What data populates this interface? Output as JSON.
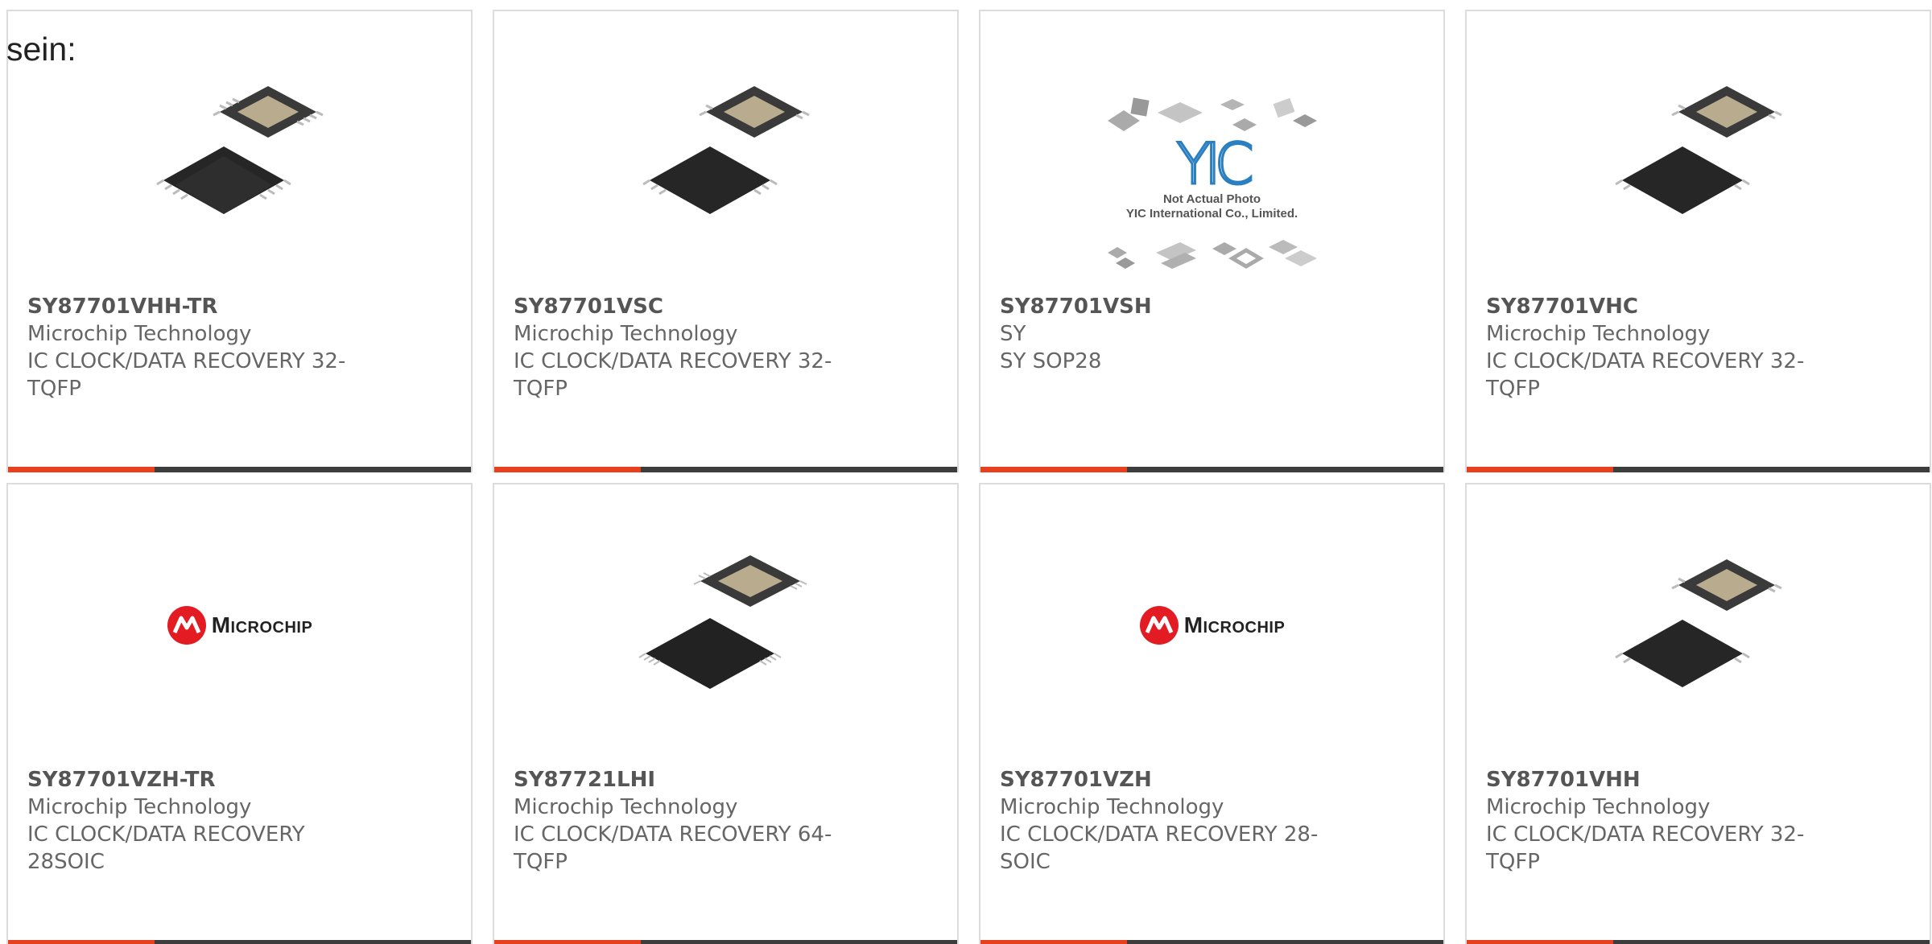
{
  "intro_text": "sein:",
  "colors": {
    "accent": "#e8401f",
    "bar": "#3d3d3d",
    "brand_red": "#e31b23",
    "yic_blue": "#2a7fc1"
  },
  "products": [
    {
      "part_number": "SY87701VHH-TR",
      "manufacturer": "Microchip Technology",
      "description": "IC CLOCK/DATA RECOVERY 32-TQFP",
      "image": "tqfp-chip-image"
    },
    {
      "part_number": "SY87701VSC",
      "manufacturer": "Microchip Technology",
      "description": "IC CLOCK/DATA RECOVERY 32-TQFP",
      "image": "tqfp-chip-image"
    },
    {
      "part_number": "SY87701VSH",
      "manufacturer": "SY",
      "description": "SY SOP28",
      "image": "yic-placeholder-image",
      "image_caption_1": "Not Actual Photo",
      "image_caption_2": "YIC International Co., Limited.",
      "image_logo_text": "YIC"
    },
    {
      "part_number": "SY87701VHC",
      "manufacturer": "Microchip Technology",
      "description": "IC CLOCK/DATA RECOVERY 32-TQFP",
      "image": "tqfp-chip-image"
    },
    {
      "part_number": "SY87701VZH-TR",
      "manufacturer": "Microchip Technology",
      "description": "IC CLOCK/DATA RECOVERY 28SOIC",
      "image": "microchip-logo",
      "logo_text": "Microchip"
    },
    {
      "part_number": "SY87721LHI",
      "manufacturer": "Microchip Technology",
      "description": "IC CLOCK/DATA RECOVERY 64-TQFP",
      "image": "tqfp-chip-image"
    },
    {
      "part_number": "SY87701VZH",
      "manufacturer": "Microchip Technology",
      "description": "IC CLOCK/DATA RECOVERY 28-SOIC",
      "image": "microchip-logo",
      "logo_text": "Microchip"
    },
    {
      "part_number": "SY87701VHH",
      "manufacturer": "Microchip Technology",
      "description": "IC CLOCK/DATA RECOVERY 32-TQFP",
      "image": "tqfp-chip-image"
    }
  ]
}
